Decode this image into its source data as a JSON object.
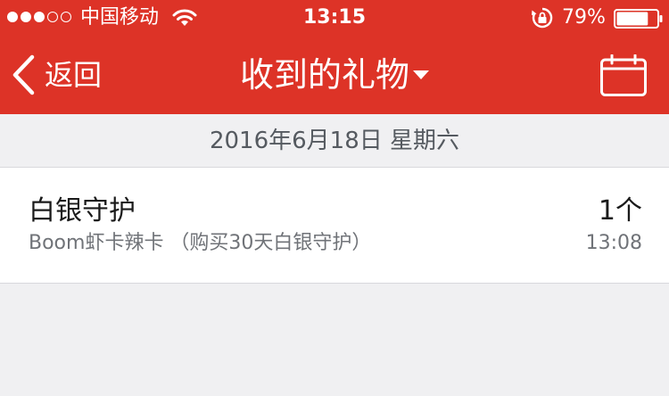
{
  "status_bar": {
    "carrier": "中国移动",
    "time": "13:15",
    "battery_percent": "79%",
    "signal_bars_filled": 3,
    "signal_bars_total": 5,
    "battery_level": 0.79
  },
  "nav": {
    "back_label": "返回",
    "title": "收到的礼物",
    "calendar_icon": "calendar-icon"
  },
  "date_header": "2016年6月18日 星期六",
  "gifts": [
    {
      "name": "白银守护",
      "description": "Boom虾卡辣卡 （购买30天白银守护）",
      "count": "1个",
      "time": "13:08"
    }
  ],
  "colors": {
    "header_red": "#dd3327",
    "background": "#f0f0f2",
    "row_background": "#ffffff"
  }
}
